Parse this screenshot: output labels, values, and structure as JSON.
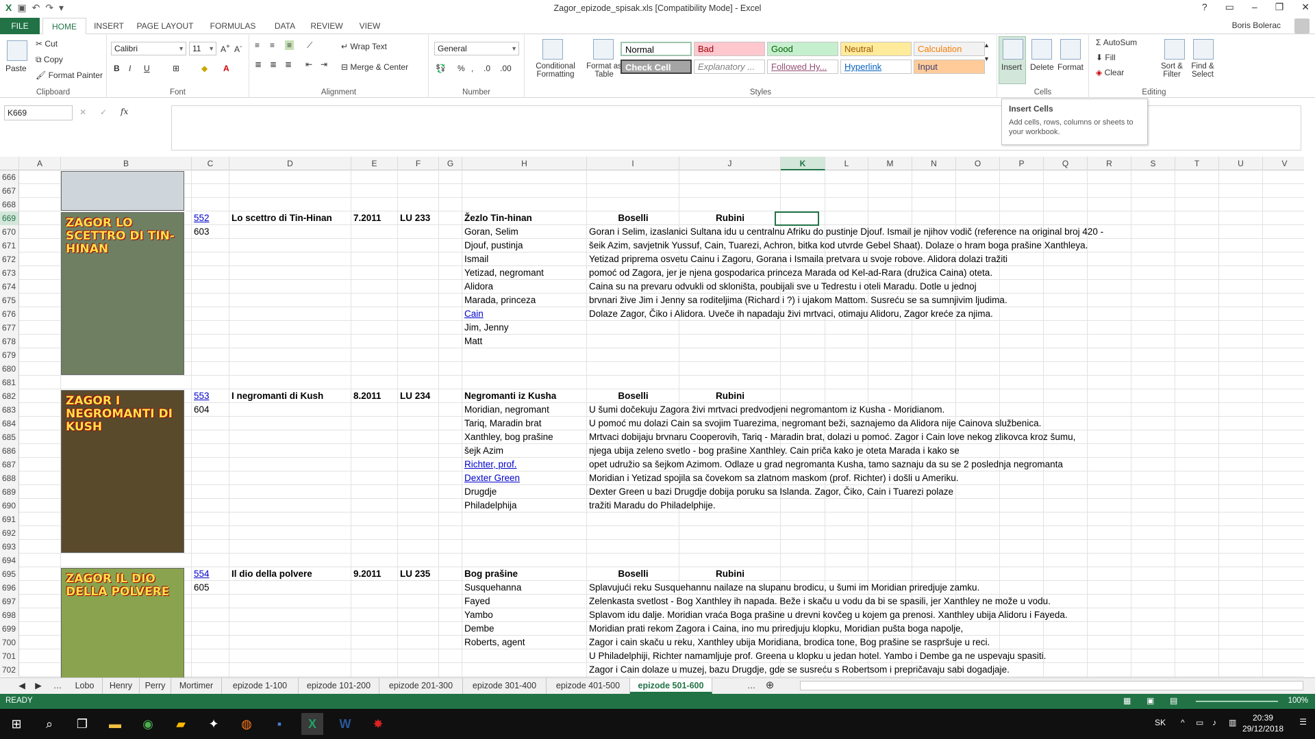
{
  "window": {
    "title": "Zagor_epizode_spisak.xls  [Compatibility Mode] - Excel",
    "user": "Boris Bolerac"
  },
  "ribbon": {
    "tabs": [
      "FILE",
      "HOME",
      "INSERT",
      "PAGE LAYOUT",
      "FORMULAS",
      "DATA",
      "REVIEW",
      "VIEW"
    ],
    "clipboard": {
      "paste": "Paste",
      "cut": "Cut",
      "copy": "Copy",
      "format_painter": "Format Painter",
      "label": "Clipboard"
    },
    "font": {
      "name": "Calibri",
      "size": "11",
      "label": "Font"
    },
    "alignment": {
      "wrap": "Wrap Text",
      "merge": "Merge & Center",
      "label": "Alignment"
    },
    "number": {
      "format": "General",
      "label": "Number"
    },
    "styles": {
      "conditional": "Conditional Formatting",
      "format_table": "Format as Table",
      "cells": [
        {
          "label": "Normal",
          "bg": "#ffffff",
          "color": "#000000"
        },
        {
          "label": "Bad",
          "bg": "#ffc7ce",
          "color": "#9c0006"
        },
        {
          "label": "Good",
          "bg": "#c6efce",
          "color": "#006100"
        },
        {
          "label": "Neutral",
          "bg": "#ffeb9c",
          "color": "#9c5700"
        },
        {
          "label": "Calculation",
          "bg": "#f2f2f2",
          "color": "#fa7d00"
        },
        {
          "label": "Check Cell",
          "bg": "#a5a5a5",
          "color": "#ffffff"
        },
        {
          "label": "Explanatory ...",
          "bg": "#ffffff",
          "color": "#7f7f7f"
        },
        {
          "label": "Followed Hy...",
          "bg": "#ffffff",
          "color": "#954f72"
        },
        {
          "label": "Hyperlink",
          "bg": "#ffffff",
          "color": "#0563c1"
        },
        {
          "label": "Input",
          "bg": "#ffcc99",
          "color": "#3f3f76"
        }
      ],
      "label": "Styles"
    },
    "cells": {
      "insert": "Insert",
      "delete": "Delete",
      "format": "Format",
      "label": "Cells"
    },
    "editing": {
      "autosum": "AutoSum",
      "fill": "Fill",
      "clear": "Clear",
      "sort": "Sort & Filter",
      "find": "Find & Select",
      "label": "Editing"
    }
  },
  "tooltip": {
    "title": "Insert Cells",
    "desc": "Add cells, rows, columns or sheets to your workbook."
  },
  "formula_bar": {
    "name_box": "K669",
    "fx": "fx",
    "value": ""
  },
  "columns": [
    {
      "id": "A",
      "w": 61
    },
    {
      "id": "B",
      "w": 191
    },
    {
      "id": "C",
      "w": 55
    },
    {
      "id": "D",
      "w": 178
    },
    {
      "id": "E",
      "w": 68
    },
    {
      "id": "F",
      "w": 60
    },
    {
      "id": "G",
      "w": 34
    },
    {
      "id": "H",
      "w": 182
    },
    {
      "id": "I",
      "w": 135
    },
    {
      "id": "J",
      "w": 148
    },
    {
      "id": "K",
      "w": 65
    },
    {
      "id": "L",
      "w": 63
    },
    {
      "id": "M",
      "w": 64
    },
    {
      "id": "N",
      "w": 64
    },
    {
      "id": "O",
      "w": 64
    },
    {
      "id": "P",
      "w": 64
    },
    {
      "id": "Q",
      "w": 64
    },
    {
      "id": "R",
      "w": 64
    },
    {
      "id": "S",
      "w": 64
    },
    {
      "id": "T",
      "w": 64
    },
    {
      "id": "U",
      "w": 64
    },
    {
      "id": "V",
      "w": 64
    }
  ],
  "selected": {
    "row": "669",
    "col": "K"
  },
  "rows": [
    {
      "n": "666",
      "cells": []
    },
    {
      "n": "667",
      "cells": []
    },
    {
      "n": "668",
      "cells": []
    },
    {
      "n": "669",
      "cells": [
        {
          "col": "C",
          "text": "552",
          "cls": "link"
        },
        {
          "col": "D",
          "text": "Lo scettro di Tin-Hinan",
          "cls": "b"
        },
        {
          "col": "E",
          "text": "7.2011",
          "cls": "b"
        },
        {
          "col": "F",
          "text": "LU 233",
          "cls": "b"
        },
        {
          "col": "H",
          "text": "Žezlo Tin-hinan",
          "cls": "b"
        },
        {
          "col": "I",
          "text": "Boselli",
          "cls": "b ctr"
        },
        {
          "col": "J",
          "text": "Rubini",
          "cls": "b ctr"
        }
      ]
    },
    {
      "n": "670",
      "cells": [
        {
          "col": "C",
          "text": "603"
        },
        {
          "col": "H",
          "text": "Goran, Selim"
        },
        {
          "col": "I",
          "text": "Goran i Selim, izaslanici Sultana idu u centralnu Afriku do pustinje Djouf. Ismail je njihov vodič (reference na original broj 420 -"
        }
      ]
    },
    {
      "n": "671",
      "cells": [
        {
          "col": "H",
          "text": "Djouf, pustinja"
        },
        {
          "col": "I",
          "text": "šeik Azim, savjetnik Yussuf, Cain, Tuarezi, Achron, bitka kod utvrde Gebel Shaat). Dolaze o hram boga prašine Xanthleya."
        }
      ]
    },
    {
      "n": "672",
      "cells": [
        {
          "col": "H",
          "text": "Ismail"
        },
        {
          "col": "I",
          "text": "Yetizad priprema osvetu Cainu i Zagoru, Gorana i Ismaila pretvara u svoje robove. Alidora dolazi tražiti"
        }
      ]
    },
    {
      "n": "673",
      "cells": [
        {
          "col": "H",
          "text": "Yetizad, negromant"
        },
        {
          "col": "I",
          "text": "pomoć od Zagora, jer je njena gospodarica princeza Marada od Kel-ad-Rara (družica Caina) oteta."
        }
      ]
    },
    {
      "n": "674",
      "cells": [
        {
          "col": "H",
          "text": "Alidora"
        },
        {
          "col": "I",
          "text": "Caina su na prevaru odvukli od skloništa, poubijali sve u Tedrestu i oteli Maradu. Dotle u jednoj"
        }
      ]
    },
    {
      "n": "675",
      "cells": [
        {
          "col": "H",
          "text": "Marada, princeza"
        },
        {
          "col": "I",
          "text": "brvnari žive Jim i Jenny sa roditeljima (Richard i ?) i ujakom Mattom. Susreću se sa sumnjivim ljudima."
        }
      ]
    },
    {
      "n": "676",
      "cells": [
        {
          "col": "H",
          "text": "Cain",
          "cls": "link"
        },
        {
          "col": "I",
          "text": "Dolaze Zagor, Čiko i Alidora. Uveče ih napadaju živi mrtvaci, otimaju Alidoru, Zagor kreće za njima."
        }
      ]
    },
    {
      "n": "677",
      "cells": [
        {
          "col": "H",
          "text": "Jim, Jenny"
        }
      ]
    },
    {
      "n": "678",
      "cells": [
        {
          "col": "H",
          "text": "Matt"
        }
      ]
    },
    {
      "n": "679",
      "cells": []
    },
    {
      "n": "680",
      "cells": []
    },
    {
      "n": "681",
      "cells": []
    },
    {
      "n": "682",
      "cells": [
        {
          "col": "C",
          "text": "553",
          "cls": "link"
        },
        {
          "col": "D",
          "text": "I negromanti di Kush",
          "cls": "b"
        },
        {
          "col": "E",
          "text": "8.2011",
          "cls": "b"
        },
        {
          "col": "F",
          "text": "LU 234",
          "cls": "b"
        },
        {
          "col": "H",
          "text": "Negromanti iz Kusha",
          "cls": "b"
        },
        {
          "col": "I",
          "text": "Boselli",
          "cls": "b ctr"
        },
        {
          "col": "J",
          "text": "Rubini",
          "cls": "b ctr"
        }
      ]
    },
    {
      "n": "683",
      "cells": [
        {
          "col": "C",
          "text": "604"
        },
        {
          "col": "H",
          "text": "Moridian, negromant"
        },
        {
          "col": "I",
          "text": "U šumi dočekuju Zagora živi mrtvaci predvodjeni negromantom iz Kusha - Moridianom."
        }
      ]
    },
    {
      "n": "684",
      "cells": [
        {
          "col": "H",
          "text": "Tariq, Maradin brat"
        },
        {
          "col": "I",
          "text": "U pomoć mu dolazi Cain sa svojim Tuarezima, negromant beži, saznajemo da Alidora nije Cainova službenica."
        }
      ]
    },
    {
      "n": "685",
      "cells": [
        {
          "col": "H",
          "text": "Xanthley, bog prašine"
        },
        {
          "col": "I",
          "text": "Mrtvaci dobijaju brvnaru Cooperovih, Tariq - Maradin brat, dolazi u pomoć. Zagor i Cain love nekog zlikovca kroz šumu,"
        }
      ]
    },
    {
      "n": "686",
      "cells": [
        {
          "col": "H",
          "text": "šejk Azim"
        },
        {
          "col": "I",
          "text": "njega ubija zeleno svetlo - bog prašine Xanthley. Cain priča kako je oteta Marada i kako se"
        }
      ]
    },
    {
      "n": "687",
      "cells": [
        {
          "col": "H",
          "text": "Richter, prof.",
          "cls": "link"
        },
        {
          "col": "I",
          "text": "opet udružio sa šejkom Azimom. Odlaze u grad negromanta Kusha, tamo saznaju da su se 2 poslednja negromanta"
        }
      ]
    },
    {
      "n": "688",
      "cells": [
        {
          "col": "H",
          "text": "Dexter Green",
          "cls": "link"
        },
        {
          "col": "I",
          "text": "Moridian i Yetizad spojila sa čovekom sa zlatnom maskom (prof. Richter) i došli u Ameriku."
        }
      ]
    },
    {
      "n": "689",
      "cells": [
        {
          "col": "H",
          "text": "Drugdje"
        },
        {
          "col": "I",
          "text": "Dexter Green u bazi Drugdje dobija poruku sa Islanda. Zagor, Čiko, Cain i Tuarezi polaze"
        }
      ]
    },
    {
      "n": "690",
      "cells": [
        {
          "col": "H",
          "text": "Philadelphija"
        },
        {
          "col": "I",
          "text": "tražiti Maradu do Philadelphije."
        }
      ]
    },
    {
      "n": "691",
      "cells": []
    },
    {
      "n": "692",
      "cells": []
    },
    {
      "n": "693",
      "cells": []
    },
    {
      "n": "694",
      "cells": []
    },
    {
      "n": "695",
      "cells": [
        {
          "col": "C",
          "text": "554",
          "cls": "link"
        },
        {
          "col": "D",
          "text": "Il dio della polvere",
          "cls": "b"
        },
        {
          "col": "E",
          "text": "9.2011",
          "cls": "b"
        },
        {
          "col": "F",
          "text": "LU 235",
          "cls": "b"
        },
        {
          "col": "H",
          "text": "Bog prašine",
          "cls": "b"
        },
        {
          "col": "I",
          "text": "Boselli",
          "cls": "b ctr"
        },
        {
          "col": "J",
          "text": "Rubini",
          "cls": "b ctr"
        }
      ]
    },
    {
      "n": "696",
      "cells": [
        {
          "col": "C",
          "text": "605"
        },
        {
          "col": "H",
          "text": "Susquehanna"
        },
        {
          "col": "I",
          "text": "Splavujući reku Susquehannu nailaze na slupanu brodicu, u šumi im Moridian priredjuje zamku."
        }
      ]
    },
    {
      "n": "697",
      "cells": [
        {
          "col": "H",
          "text": "Fayed"
        },
        {
          "col": "I",
          "text": "Zelenkasta svetlost - Bog Xanthley ih napada. Beže i skaču u vodu da bi se spasili, jer Xanthley ne može u vodu."
        }
      ]
    },
    {
      "n": "698",
      "cells": [
        {
          "col": "H",
          "text": "Yambo"
        },
        {
          "col": "I",
          "text": "Splavom idu dalje. Moridian vraća Boga prašine u drevni kovčeg u kojem ga prenosi. Xanthley ubija Alidoru i Fayeda."
        }
      ]
    },
    {
      "n": "699",
      "cells": [
        {
          "col": "H",
          "text": "Dembe"
        },
        {
          "col": "I",
          "text": "Moridian prati rekom Zagora i Caina, ino mu priredjuju klopku, Moridian pušta boga napolje,"
        }
      ]
    },
    {
      "n": "700",
      "cells": [
        {
          "col": "H",
          "text": "Roberts, agent"
        },
        {
          "col": "I",
          "text": "Zagor i cain skaču u reku, Xanthley ubija Moridiana, brodica tone, Bog prašine se raspršuje u reci."
        }
      ]
    },
    {
      "n": "701",
      "cells": [
        {
          "col": "I",
          "text": "U Philadelphiji, Richter namamljuje prof. Greena u klopku u jedan hotel. Yambo i Dembe ga ne uspevaju spasiti."
        }
      ]
    },
    {
      "n": "702",
      "cells": [
        {
          "col": "I",
          "text": "Zagor i Cain dolaze u muzej, bazu Drugdje, gde se susreću s Robertsom i prepričavaju sabi dogadjaje."
        }
      ]
    }
  ],
  "covers": [
    {
      "title": "",
      "bg": "#cfd6db"
    },
    {
      "title": "ZAGOR LO SCETTRO DI TIN-HINAN",
      "bg": "#6f7f62"
    },
    {
      "title": "ZAGOR I NEGROMANTI DI KUSH",
      "bg": "#5a4a2c"
    },
    {
      "title": "ZAGOR IL DIO DELLA POLVERE",
      "bg": "#8aa34f"
    }
  ],
  "sheets": [
    "Lobo",
    "Henry",
    "Perry",
    "Mortimer",
    "epizode 1-100",
    "epizode 101-200",
    "epizode 201-300",
    "epizode 301-400",
    "epizode 401-500",
    "epizode 501-600"
  ],
  "active_sheet": "epizode 501-600",
  "status": {
    "ready": "READY",
    "zoom": "100%"
  },
  "taskbar": {
    "lang": "SK",
    "time": "20:39",
    "date": "29/12/2018"
  }
}
